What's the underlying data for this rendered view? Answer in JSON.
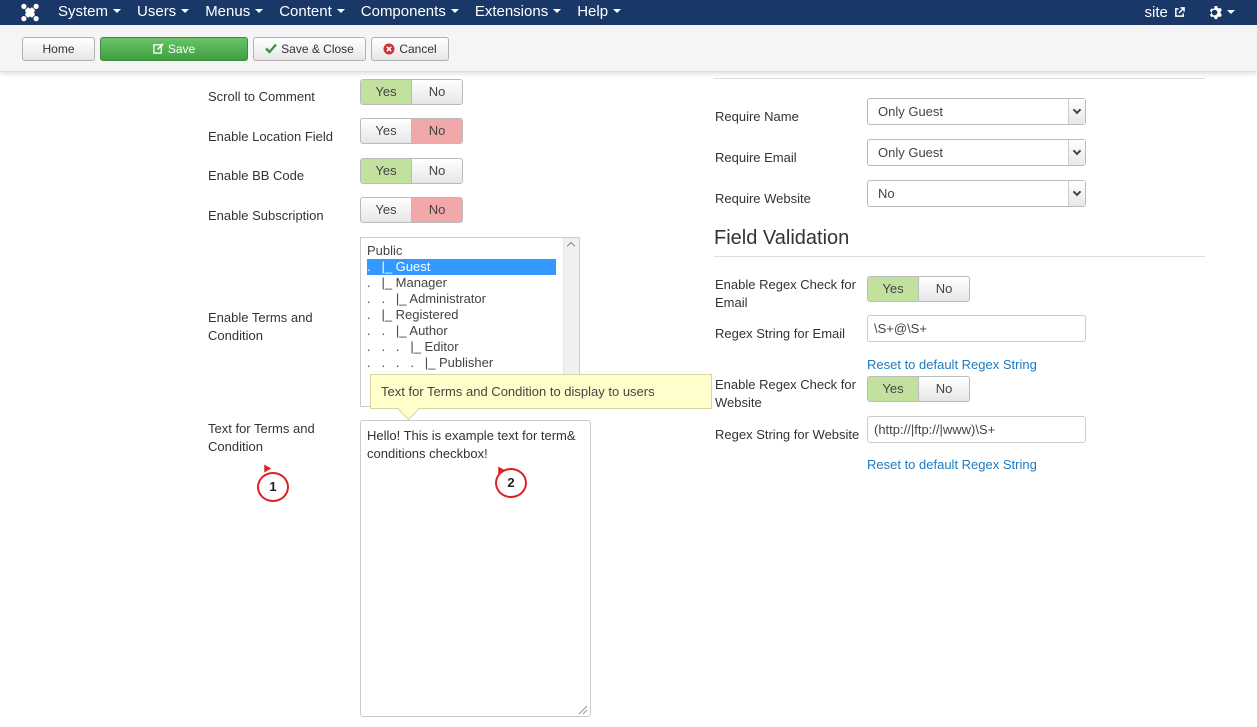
{
  "navbar": {
    "brand": "joomla-logo",
    "menus": [
      {
        "label": "System"
      },
      {
        "label": "Users"
      },
      {
        "label": "Menus"
      },
      {
        "label": "Content"
      },
      {
        "label": "Components"
      },
      {
        "label": "Extensions"
      },
      {
        "label": "Help"
      }
    ],
    "site_link": "site",
    "bg_color": "#1a3867"
  },
  "toolbar": {
    "home": "Home",
    "save": "Save",
    "save_close": "Save & Close",
    "cancel": "Cancel"
  },
  "left_form": {
    "scroll_to_comment": {
      "label": "Scroll to Comment",
      "yes": "Yes",
      "no": "No",
      "value": "Yes"
    },
    "enable_location": {
      "label": "Enable Location Field",
      "yes": "Yes",
      "no": "No",
      "value": "No"
    },
    "enable_bbcode": {
      "label": "Enable BB Code",
      "yes": "Yes",
      "no": "No",
      "value": "Yes"
    },
    "enable_subscription": {
      "label": "Enable Subscription",
      "yes": "Yes",
      "no": "No",
      "value": "No"
    },
    "terms_groups": {
      "label_line1": "Enable Terms and",
      "label_line2": "Condition",
      "options": [
        "Public",
        ".   |_ Guest",
        ".   |_ Manager",
        ".   .   |_ Administrator",
        ".   |_ Registered",
        ".   .   |_ Author",
        ".   .   .   |_ Editor",
        ".   .   .   .   |_ Publisher"
      ],
      "selected": ".   |_ Guest"
    },
    "tooltip": "Text for Terms and Condition to display to users",
    "terms_text": {
      "label_line1": "Text for Terms and",
      "label_line2": "Condition",
      "value_line1": "Hello! This is example text for term&",
      "value_line2": "conditions checkbox!"
    },
    "callout1": "1",
    "callout2": "2"
  },
  "right_form": {
    "require_name": {
      "label": "Require Name",
      "value": "Only Guest"
    },
    "require_email": {
      "label": "Require Email",
      "value": "Only Guest"
    },
    "require_website": {
      "label": "Require Website",
      "value": "No"
    },
    "section_title": "Field Validation",
    "regex_email_check": {
      "label_line1": "Enable Regex Check for",
      "label_line2": "Email",
      "yes": "Yes",
      "no": "No",
      "value": "Yes"
    },
    "regex_email": {
      "label": "Regex String for Email",
      "value": "\\S+@\\S+",
      "reset": "Reset to default Regex String"
    },
    "regex_website_check": {
      "label_line1": "Enable Regex Check for",
      "label_line2": "Website",
      "yes": "Yes",
      "no": "No",
      "value": "Yes"
    },
    "regex_website": {
      "label": "Regex String for Website",
      "value": "(http://|ftp://|www)\\S+",
      "reset": "Reset to default Regex String"
    }
  },
  "colors": {
    "yes_active": "#c3e19e",
    "no_active": "#f2a8a8",
    "save_green": "#46a546",
    "link": "#1a7cc2"
  }
}
